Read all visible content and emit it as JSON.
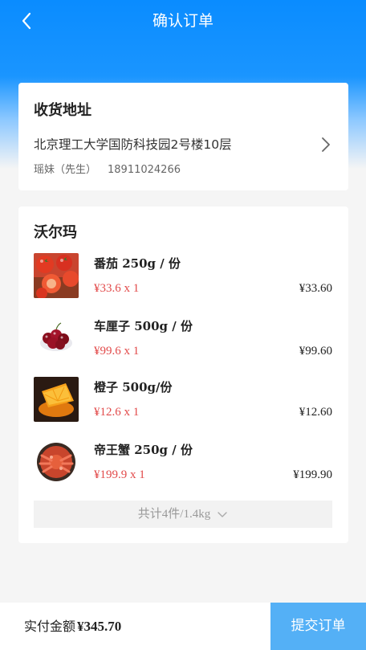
{
  "header": {
    "title": "确认订单",
    "back_icon": "chevron-left-icon"
  },
  "address": {
    "title": "收货地址",
    "line": "北京理工大学国防科技园2号楼10层",
    "name": "瑶妹（先生）",
    "phone": "18911024266"
  },
  "store": {
    "name": "沃尔玛",
    "items": [
      {
        "name": "番茄 250g / 份",
        "unit_price": "¥33.6 x 1",
        "total": "¥33.60",
        "icon": "tomato-image"
      },
      {
        "name": "车厘子 500g / 份",
        "unit_price": "¥99.6 x 1",
        "total": "¥99.60",
        "icon": "cherry-image"
      },
      {
        "name": "橙子 500g/份",
        "unit_price": "¥12.6 x 1",
        "total": "¥12.60",
        "icon": "orange-image"
      },
      {
        "name": "帝王蟹 250g / 份",
        "unit_price": "¥199.9 x 1",
        "total": "¥199.90",
        "icon": "king-crab-image"
      }
    ],
    "summary": "共计4件/1.4kg"
  },
  "footer": {
    "pay_label": "实付金额",
    "pay_amount": "¥345.70",
    "submit_label": "提交订单"
  },
  "colors": {
    "primary": "#0a8cff",
    "submit": "#54b0f6",
    "price_red": "#e24a4a"
  }
}
